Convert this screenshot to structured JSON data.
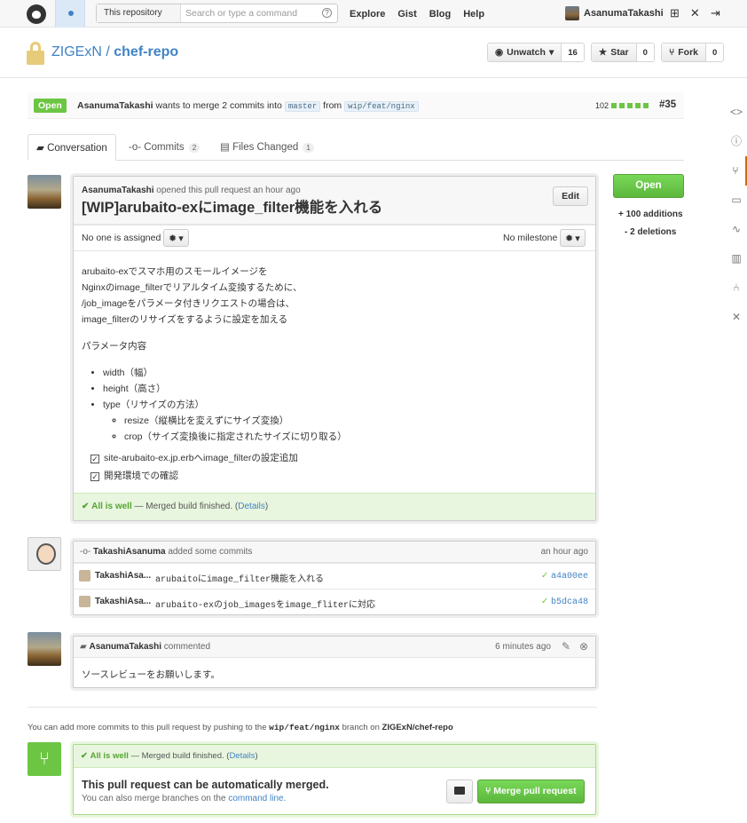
{
  "header": {
    "scope": "This repository",
    "search_placeholder": "Search or type a command",
    "help": "?",
    "nav": [
      "Explore",
      "Gist",
      "Blog",
      "Help"
    ],
    "username": "AsanumaTakashi"
  },
  "repo": {
    "owner": "ZIGExN",
    "sep": "/",
    "name": "chef-repo",
    "watch_label": "Unwatch",
    "watch_count": "16",
    "star_label": "Star",
    "star_count": "0",
    "fork_label": "Fork",
    "fork_count": "0"
  },
  "pr": {
    "state": "Open",
    "author": "AsanumaTakashi",
    "text_pre": "wants to merge 2 commits into",
    "base": "master",
    "text_from": "from",
    "head": "wip/feat/nginx",
    "additions_short": "102",
    "number": "#35"
  },
  "tabs": [
    {
      "label": "Conversation",
      "count": ""
    },
    {
      "label": "Commits",
      "count": "2"
    },
    {
      "label": "Files Changed",
      "count": "1"
    }
  ],
  "opening": {
    "author": "AsanumaTakashi",
    "meta": "opened this pull request an hour ago",
    "edit": "Edit",
    "title": "[WIP]arubaito-exにimage_filter機能を入れる",
    "assignee": "No one is assigned",
    "milestone": "No milestone",
    "body_lines": [
      "arubaito-exでスマホ用のスモールイメージを",
      "Nginxのimage_filterでリアルタイム変換するために、",
      "/job_imageをパラメータ付きリクエストの場合は、",
      "image_filterのリサイズをするように設定を加える"
    ],
    "params_title": "パラメータ内容",
    "params": [
      "width（幅）",
      "height（高さ）",
      "type（リサイズの方法）"
    ],
    "subparams": [
      "resize（縦横比を変えずにサイズ変換）",
      "crop（サイズ変換後に指定されたサイズに切り取る）"
    ],
    "tasks": [
      "site-arubaito-ex.jp.erbへimage_filterの設定追加",
      "開発環境での確認"
    ],
    "status_ok": "All is well",
    "status_text": "— Merged build finished. (",
    "status_link": "Details",
    "status_close": ")"
  },
  "sidebar": {
    "state": "Open",
    "additions": "+ 100 additions",
    "deletions": "- 2 deletions"
  },
  "commits_event": {
    "author": "TakashiAsanuma",
    "meta": "added some commits",
    "time": "an hour ago",
    "commits": [
      {
        "author": "TakashiAsa...",
        "message": "arubaitoにimage_filter機能を入れる",
        "sha": "a4a00ee"
      },
      {
        "author": "TakashiAsa...",
        "message": "arubaito-exのjob_imagesをimage_fliterに対応",
        "sha": "b5dca48"
      }
    ]
  },
  "comment": {
    "author": "AsanumaTakashi",
    "meta": "commented",
    "time": "6 minutes ago",
    "body": "ソースレビューをお願いします。"
  },
  "footer": {
    "text_pre": "You can add more commits to this pull request by pushing to the",
    "branch": "wip/feat/nginx",
    "text_mid": "branch on",
    "repo": "ZIGExN/chef-repo",
    "status_ok": "All is well",
    "status_text": "— Merged build finished. (",
    "status_link": "Details",
    "status_close": ")",
    "merge_title": "This pull request can be automatically merged.",
    "merge_sub": "You can also merge branches on the",
    "merge_link": "command line.",
    "merge_button": "Merge pull request"
  }
}
